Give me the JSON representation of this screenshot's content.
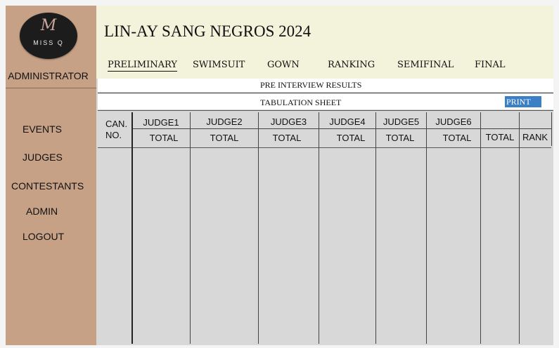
{
  "sidebar": {
    "logo_letter": "M",
    "logo_text": "MISS Q",
    "role_label": "ADMINISTRATOR",
    "nav": [
      "EVENTS",
      "JUDGES",
      "CONTESTANTS",
      "ADMIN",
      "LOGOUT"
    ]
  },
  "header": {
    "title": "LIN-AY SANG NEGROS 2024",
    "tabs": [
      "PRELIMINARY",
      "SWIMSUIT",
      "GOWN",
      "RANKING",
      "SEMIFINAL",
      "FINAL"
    ],
    "active_tab": "PRELIMINARY"
  },
  "report": {
    "subtitle": "PRE INTERVIEW RESULTS",
    "sheet_title": "TABULATION SHEET",
    "print_label": "PRINT"
  },
  "table": {
    "can_no_line1": "CAN.",
    "can_no_line2": "NO.",
    "judges": [
      "JUDGE1",
      "JUDGE2",
      "JUDGE3",
      "JUDGE4",
      "JUDGE5",
      "JUDGE6"
    ],
    "sub_header": "TOTAL",
    "total_header": "TOTAL",
    "rank_header": "RANK",
    "rows": []
  },
  "colors": {
    "sidebar": "#c6a186",
    "header": "#f3f2da",
    "print_button": "#3b7fc4",
    "table_bg": "#d8d8d8"
  }
}
